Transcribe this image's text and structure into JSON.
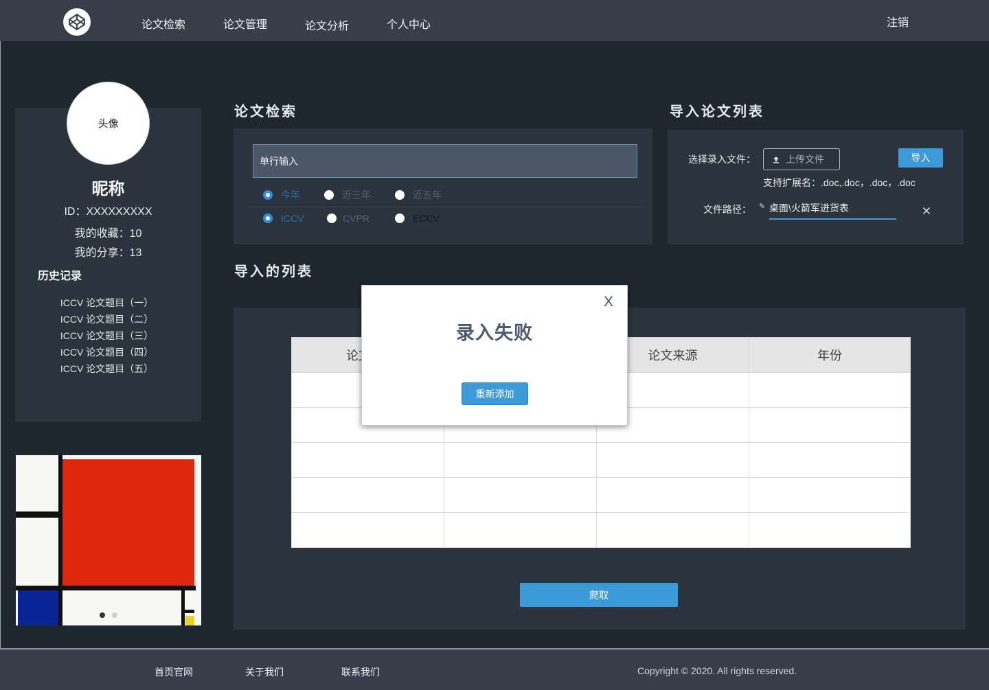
{
  "header": {
    "logo_icon": "codepen-icon",
    "nav": [
      "论文检索",
      "论文管理",
      "论文分析",
      "个人中心"
    ],
    "logout_label": "注销"
  },
  "profile": {
    "avatar_label": "头像",
    "nickname": "昵称",
    "id_text": "ID：XXXXXXXXX",
    "favorites_text": "我的收藏：10",
    "shares_text": "我的分享：13",
    "history_title": "历史记录",
    "history": [
      "ICCV 论文题目（一）",
      "ICCV 论文题目（二）",
      "ICCV 论文题目（三）",
      "ICCV 论文题目（四）",
      "ICCV 论文题目（五）"
    ]
  },
  "carousel": {
    "dots": [
      {
        "active": true
      },
      {
        "active": false
      }
    ]
  },
  "search": {
    "title": "论文检索",
    "input_placeholder": "单行输入",
    "time_options": [
      {
        "label": "今年",
        "checked": true
      },
      {
        "label": "近三年",
        "checked": false
      },
      {
        "label": "近五年",
        "checked": false
      }
    ],
    "venue_options": [
      {
        "label": "ICCV",
        "checked": true
      },
      {
        "label": "CVPR",
        "checked": false
      },
      {
        "label": "ECCV",
        "checked": false
      }
    ]
  },
  "import": {
    "title": "导入论文列表",
    "select_file_label": "选择录入文件：",
    "upload_icon": "upload-icon",
    "upload_label": "上传文件",
    "import_button": "导入",
    "extensions_text": "支持扩展名：.doc,.doc，.doc，.doc",
    "path_label": "文件路径：",
    "path_icon": "pencil-icon",
    "path_value": "桌面\\火箭军进货表",
    "clear_icon": "close-icon"
  },
  "imported_list": {
    "title": "导入的列表",
    "columns": [
      "论文",
      "",
      "论文来源",
      "年份"
    ],
    "rows": [
      [
        "",
        "",
        "",
        ""
      ],
      [
        "",
        "",
        "",
        ""
      ],
      [
        "",
        "",
        "",
        ""
      ],
      [
        "",
        "",
        "",
        ""
      ],
      [
        "",
        "",
        "",
        ""
      ]
    ],
    "crawl_button": "爬取"
  },
  "modal": {
    "close_label": "X",
    "title": "录入失败",
    "retry_button": "重新添加"
  },
  "footer": {
    "links": [
      "首页官网",
      "关于我们",
      "联系我们"
    ],
    "copyright": "Copyright © 2020. All rights reserved."
  },
  "colors": {
    "header_bg": "#373e49",
    "page_bg": "#1f272e",
    "panel_bg": "#2b333c",
    "input_bg": "#4b5667",
    "primary_blue": "#3d9ad9",
    "table_header_bg": "#e5e5e5",
    "modal_title": "#4b5a6e"
  }
}
